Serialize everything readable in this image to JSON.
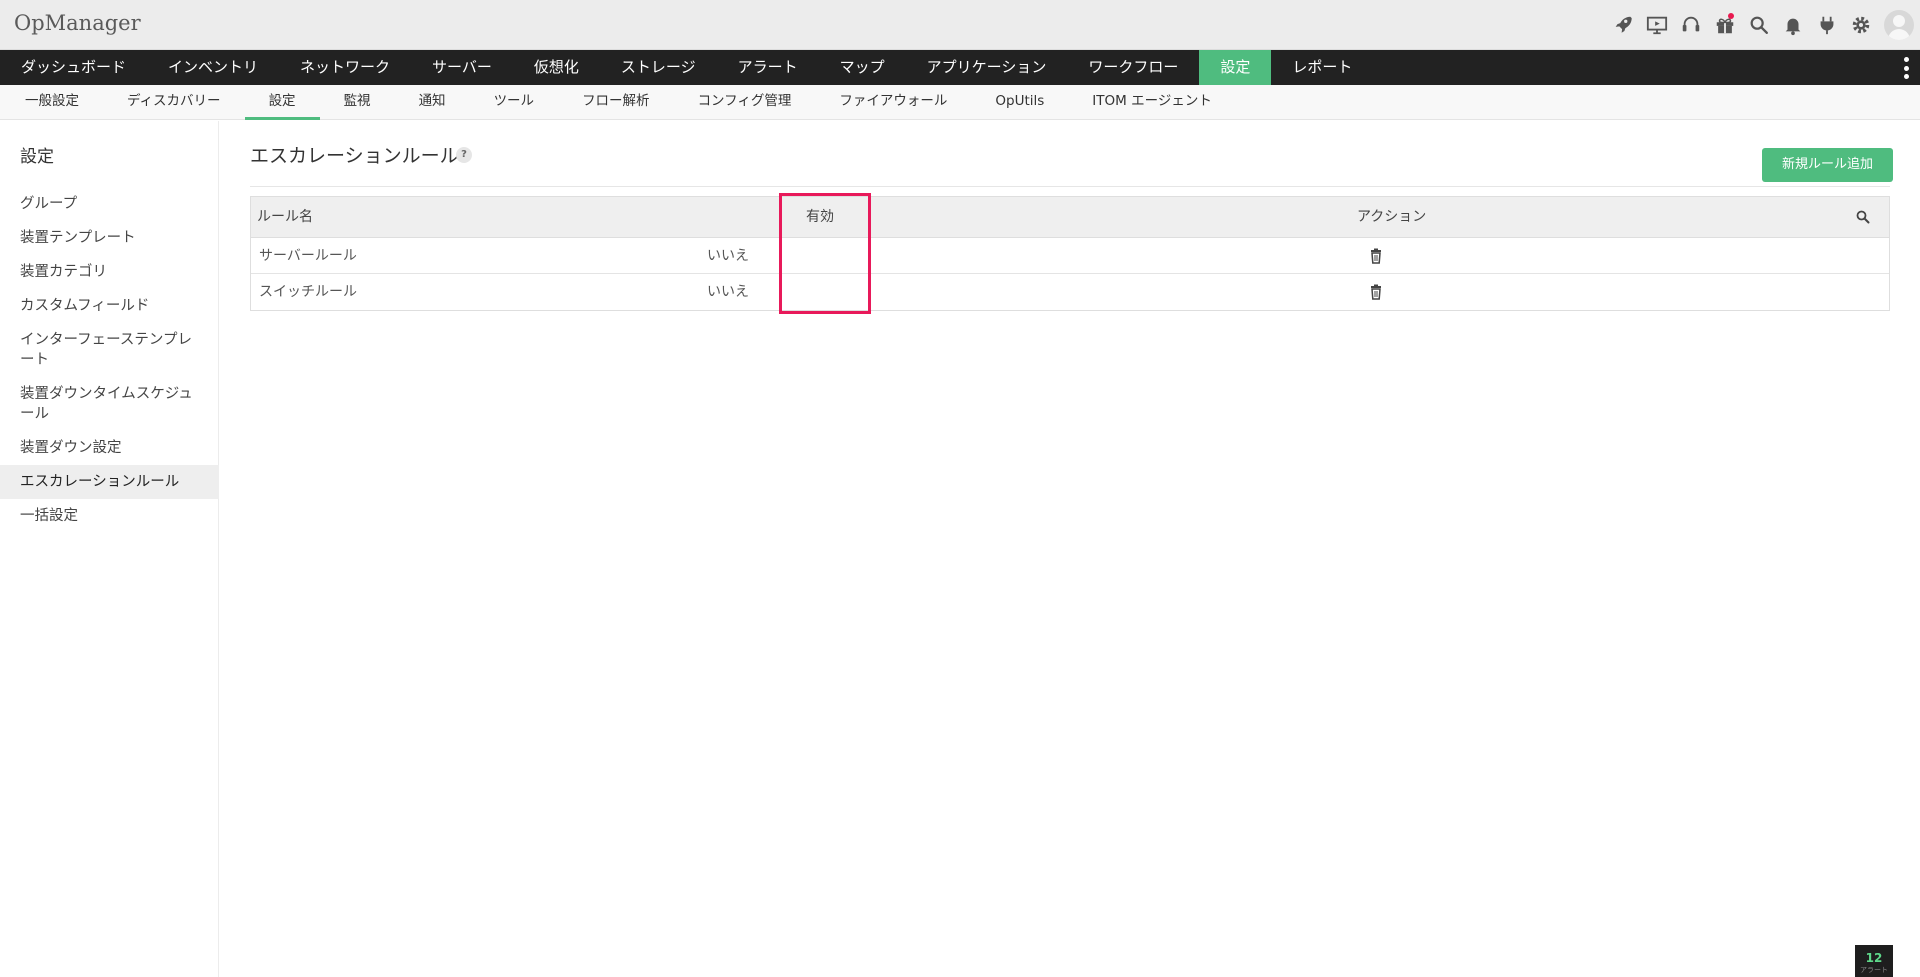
{
  "app": {
    "title": "OpManager"
  },
  "top_icons": [
    "rocket-icon",
    "presentation-icon",
    "headset-icon",
    "gift-icon",
    "search-icon",
    "bell-icon",
    "plug-icon",
    "gear-icon",
    "avatar"
  ],
  "colors": {
    "accent": "#4fbc7f",
    "nav_bg": "#222222",
    "highlight": "#e8195a",
    "header_bg": "#ececec"
  },
  "main_nav": {
    "items": [
      "ダッシュボード",
      "インベントリ",
      "ネットワーク",
      "サーバー",
      "仮想化",
      "ストレージ",
      "アラート",
      "マップ",
      "アプリケーション",
      "ワークフロー",
      "設定",
      "レポート"
    ],
    "active": "設定"
  },
  "sub_nav": {
    "items": [
      "一般設定",
      "ディスカバリー",
      "設定",
      "監視",
      "通知",
      "ツール",
      "フロー解析",
      "コンフィグ管理",
      "ファイアウォール",
      "OpUtils",
      "ITOM エージェント"
    ],
    "active": "設定"
  },
  "sidebar": {
    "title": "設定",
    "items": [
      "グループ",
      "装置テンプレート",
      "装置カテゴリ",
      "カスタムフィールド",
      "インターフェーステンプレート",
      "装置ダウンタイムスケジュール",
      "装置ダウン設定",
      "エスカレーションルール",
      "一括設定"
    ],
    "active": "エスカレーションルール"
  },
  "page": {
    "title": "エスカレーションルール",
    "help": "?",
    "add_button": "新規ルール追加"
  },
  "table": {
    "columns": {
      "name": "ルール名",
      "enabled": "有効",
      "action": "アクション"
    },
    "rows": [
      {
        "name": "サーバールール",
        "enabled": "いいえ"
      },
      {
        "name": "スイッチルール",
        "enabled": "いいえ"
      }
    ]
  },
  "alarm": {
    "count": "12",
    "label": "アラート"
  }
}
